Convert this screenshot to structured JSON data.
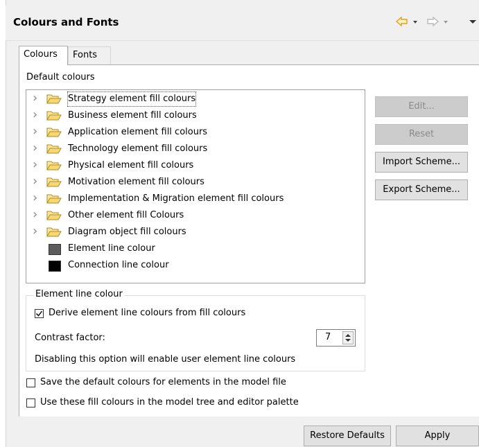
{
  "header": {
    "title": "Colours and Fonts"
  },
  "tabs": [
    {
      "label": "Colours",
      "active": true
    },
    {
      "label": "Fonts",
      "active": false
    }
  ],
  "default_colours_label": "Default colours",
  "tree": {
    "items": [
      {
        "label": "Strategy element fill colours",
        "type": "folder",
        "focused": true
      },
      {
        "label": "Business element fill colours",
        "type": "folder"
      },
      {
        "label": "Application element fill colours",
        "type": "folder"
      },
      {
        "label": "Technology element fill colours",
        "type": "folder"
      },
      {
        "label": "Physical element fill colours",
        "type": "folder"
      },
      {
        "label": "Motivation element fill colours",
        "type": "folder"
      },
      {
        "label": "Implementation & Migration element fill colours",
        "type": "folder"
      },
      {
        "label": "Other element fill Colours",
        "type": "folder"
      },
      {
        "label": "Diagram object fill colours",
        "type": "folder"
      },
      {
        "label": "Element line colour",
        "type": "colour",
        "colour": "#5c5c5c"
      },
      {
        "label": "Connection line colour",
        "type": "colour",
        "colour": "#000000"
      }
    ]
  },
  "side_buttons": {
    "edit": "Edit...",
    "reset": "Reset",
    "import": "Import Scheme...",
    "export": "Export Scheme..."
  },
  "element_line": {
    "legend": "Element line colour",
    "derive_label": "Derive element line colours from fill colours",
    "derive_checked": true,
    "contrast_label": "Contrast factor:",
    "contrast_value": "7",
    "note": "Disabling this option will enable user element line colours"
  },
  "options": {
    "save_default": "Save the default colours for elements in the model file",
    "use_fill": "Use these fill colours in the model tree and editor palette"
  },
  "footer": {
    "restore": "Restore Defaults",
    "apply": "Apply"
  },
  "colors": {
    "folder_fill": "#f7d774",
    "folder_stroke": "#b08a1e",
    "nav_arrow": "#e0b030"
  }
}
